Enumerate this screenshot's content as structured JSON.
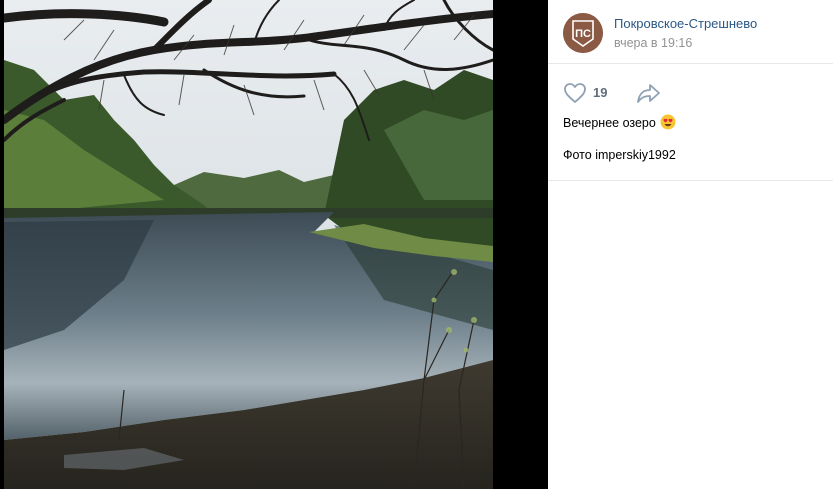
{
  "post": {
    "author": "Покровское-Стрешнево",
    "time": "вчера в 19:16",
    "likes": "19",
    "caption": "Вечернее озеро",
    "caption_emoji": "heart-eyes-emoji",
    "credit": "Фото imperskiy1992"
  },
  "avatar": {
    "logo_text": "ПС",
    "colors": {
      "bg": "#8b5a44",
      "ring": "#ffffff"
    }
  },
  "icons": {
    "like": "heart-icon",
    "share": "share-arrow-icon"
  },
  "colors": {
    "link": "#2a5885",
    "meta": "#939393",
    "border": "#e7e8ec",
    "icon": "#8fa1b4"
  }
}
